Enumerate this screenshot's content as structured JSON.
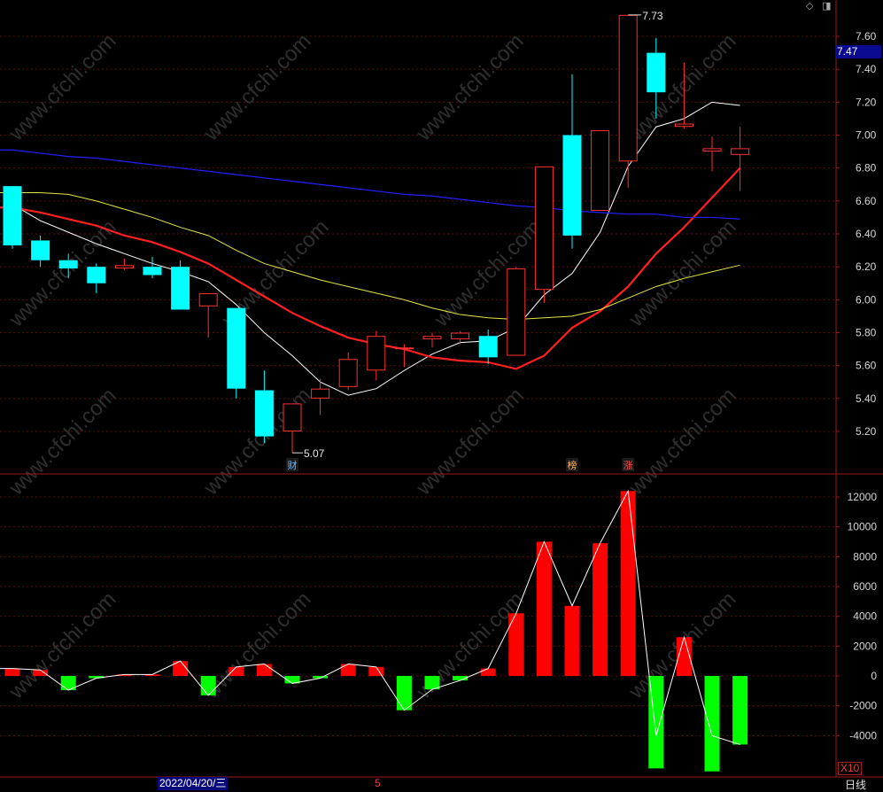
{
  "price_tag": "7.47",
  "period": "日线",
  "date_label": "2022/04/20/三",
  "tick_label": "5",
  "volume_multiplier": "X10",
  "watermark": "www.cfchi.com",
  "high_label": "7.73",
  "low_label": "5.07",
  "markers": [
    {
      "text": "财",
      "color": "#6fb4ff",
      "candle": 10
    },
    {
      "text": "榜",
      "color": "#ffb060",
      "candle": 20
    },
    {
      "text": "涨",
      "color": "#ff5050",
      "candle": 22
    }
  ],
  "icons": [
    "diamond-icon",
    "window-toggle-icon"
  ],
  "colors": {
    "up": "#ff3030",
    "down": "#00ffff",
    "ma5": "#ffffff",
    "ma10": "#ff2020",
    "ma20": "#e6e642",
    "ma60": "#2020ff",
    "vol_up": "#ff0000",
    "vol_down": "#00ff00"
  },
  "chart_data": [
    {
      "type": "candlestick",
      "yticks": [
        "7.60",
        "7.40",
        "7.20",
        "7.00",
        "6.80",
        "6.60",
        "6.40",
        "6.20",
        "6.00",
        "5.80",
        "5.60",
        "5.40",
        "5.20"
      ],
      "ylim": [
        5.0,
        7.75
      ],
      "candles": [
        {
          "o": 6.69,
          "h": 6.69,
          "l": 6.31,
          "c": 6.33
        },
        {
          "o": 6.36,
          "h": 6.39,
          "l": 6.2,
          "c": 6.24
        },
        {
          "o": 6.24,
          "h": 6.28,
          "l": 6.13,
          "c": 6.19
        },
        {
          "o": 6.2,
          "h": 6.22,
          "l": 6.04,
          "c": 6.1
        },
        {
          "o": 6.19,
          "h": 6.25,
          "l": 6.18,
          "c": 6.21
        },
        {
          "o": 6.2,
          "h": 6.26,
          "l": 6.13,
          "c": 6.15
        },
        {
          "o": 6.2,
          "h": 6.24,
          "l": 5.94,
          "c": 5.94
        },
        {
          "o": 5.96,
          "h": 6.03,
          "l": 5.77,
          "c": 6.04
        },
        {
          "o": 5.95,
          "h": 5.95,
          "l": 5.4,
          "c": 5.46
        },
        {
          "o": 5.45,
          "h": 5.57,
          "l": 5.13,
          "c": 5.17
        },
        {
          "o": 5.2,
          "h": 5.37,
          "l": 5.07,
          "c": 5.37
        },
        {
          "o": 5.4,
          "h": 5.52,
          "l": 5.3,
          "c": 5.46
        },
        {
          "o": 5.47,
          "h": 5.68,
          "l": 5.45,
          "c": 5.64
        },
        {
          "o": 5.57,
          "h": 5.81,
          "l": 5.51,
          "c": 5.78
        },
        {
          "o": 5.71,
          "h": 5.73,
          "l": 5.59,
          "c": 5.71
        },
        {
          "o": 5.76,
          "h": 5.8,
          "l": 5.71,
          "c": 5.78
        },
        {
          "o": 5.76,
          "h": 5.81,
          "l": 5.73,
          "c": 5.8
        },
        {
          "o": 5.78,
          "h": 5.82,
          "l": 5.61,
          "c": 5.65
        },
        {
          "o": 5.66,
          "h": 6.2,
          "l": 5.66,
          "c": 6.19
        },
        {
          "o": 6.06,
          "h": 6.81,
          "l": 5.98,
          "c": 6.81
        },
        {
          "o": 7.0,
          "h": 7.37,
          "l": 6.31,
          "c": 6.39
        },
        {
          "o": 6.54,
          "h": 7.03,
          "l": 6.54,
          "c": 7.03
        },
        {
          "o": 6.84,
          "h": 7.73,
          "l": 6.68,
          "c": 7.73
        },
        {
          "o": 7.5,
          "h": 7.59,
          "l": 7.1,
          "c": 7.26
        },
        {
          "o": 7.05,
          "h": 7.44,
          "l": 7.04,
          "c": 7.07
        },
        {
          "o": 6.9,
          "h": 6.99,
          "l": 6.78,
          "c": 6.92
        },
        {
          "o": 6.88,
          "h": 7.05,
          "l": 6.66,
          "c": 6.92
        }
      ],
      "series": [
        {
          "name": "MA5",
          "values": [
            6.58,
            6.48,
            6.41,
            6.34,
            6.28,
            6.22,
            6.17,
            6.11,
            5.97,
            5.8,
            5.66,
            5.5,
            5.42,
            5.46,
            5.57,
            5.67,
            5.74,
            5.75,
            5.83,
            6.03,
            6.16,
            6.41,
            6.81,
            7.05,
            7.1,
            7.2,
            7.18
          ]
        },
        {
          "name": "MA10",
          "values": [
            6.56,
            6.53,
            6.49,
            6.45,
            6.39,
            6.35,
            6.29,
            6.22,
            6.12,
            6.02,
            5.92,
            5.84,
            5.77,
            5.73,
            5.7,
            5.65,
            5.63,
            5.62,
            5.58,
            5.66,
            5.83,
            5.93,
            6.08,
            6.28,
            6.44,
            6.62,
            6.8
          ]
        },
        {
          "name": "MA20",
          "values": [
            6.65,
            6.65,
            6.64,
            6.6,
            6.55,
            6.5,
            6.44,
            6.39,
            6.3,
            6.22,
            6.17,
            6.12,
            6.08,
            6.04,
            6.0,
            5.95,
            5.91,
            5.89,
            5.88,
            5.89,
            5.9,
            5.94,
            6.01,
            6.08,
            6.13,
            6.17,
            6.21
          ]
        },
        {
          "name": "MA60",
          "values": [
            6.91,
            6.89,
            6.87,
            6.86,
            6.84,
            6.82,
            6.8,
            6.78,
            6.76,
            6.74,
            6.72,
            6.7,
            6.68,
            6.66,
            6.64,
            6.63,
            6.61,
            6.59,
            6.57,
            6.56,
            6.54,
            6.53,
            6.52,
            6.52,
            6.5,
            6.5,
            6.49
          ]
        }
      ]
    },
    {
      "type": "bar",
      "yticks": [
        "12000",
        "10000",
        "8000",
        "6000",
        "4000",
        "2000",
        "0",
        "-2000",
        "-4000"
      ],
      "ylim": [
        -6500,
        13000
      ],
      "values": [
        500,
        400,
        -950,
        -150,
        100,
        100,
        1000,
        -1300,
        600,
        800,
        -500,
        -150,
        800,
        600,
        -2300,
        -900,
        -300,
        500,
        4200,
        9000,
        4700,
        8900,
        12400,
        -6200,
        2600,
        -6400,
        -4600
      ],
      "series": [
        {
          "name": "line",
          "values": [
            500,
            400,
            -950,
            -150,
            100,
            100,
            1000,
            -1300,
            600,
            800,
            -500,
            -150,
            800,
            600,
            -2300,
            -900,
            -300,
            500,
            4200,
            9000,
            4700,
            8900,
            12400,
            -4000,
            2600,
            -4000,
            -4600
          ]
        }
      ]
    }
  ]
}
